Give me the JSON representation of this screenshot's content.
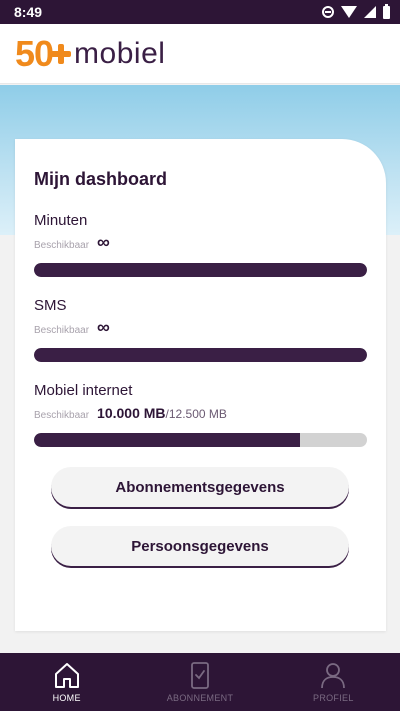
{
  "status_bar": {
    "time": "8:49"
  },
  "header": {
    "logo_number": "50",
    "logo_word": "mobiel"
  },
  "dashboard": {
    "title": "Mijn dashboard",
    "available_label": "Beschikbaar",
    "usages": [
      {
        "label": "Minuten",
        "value": "∞",
        "fill_fraction": 1.0
      },
      {
        "label": "SMS",
        "value": "∞",
        "fill_fraction": 1.0
      },
      {
        "label": "Mobiel internet",
        "value": "10.000 MB",
        "total": "/12.500 MB",
        "fill_fraction": 0.8
      }
    ]
  },
  "buttons": {
    "subscription": "Abonnementsgegevens",
    "personal": "Persoonsgegevens"
  },
  "bottom_nav": {
    "items": [
      {
        "label": "HOME",
        "icon": "home-icon",
        "active": true
      },
      {
        "label": "ABONNEMENT",
        "icon": "phone-check-icon",
        "active": false
      },
      {
        "label": "PROFIEL",
        "icon": "user-icon",
        "active": false
      }
    ]
  },
  "colors": {
    "brand_purple": "#3a1f45",
    "brand_orange": "#f08a1c",
    "sky_blue": "#8fcde8"
  }
}
